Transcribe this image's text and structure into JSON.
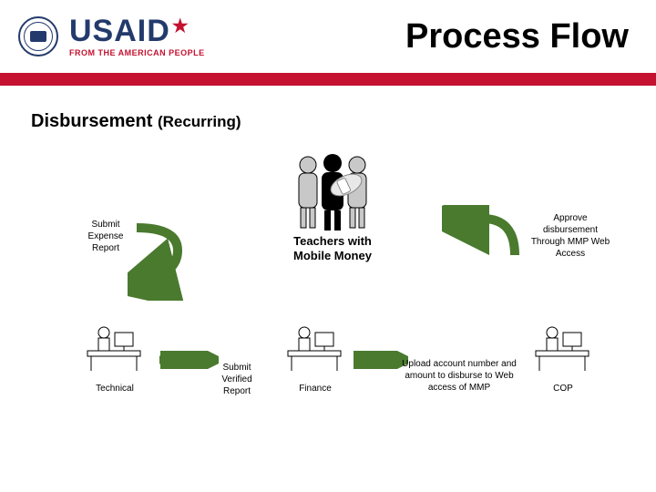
{
  "header": {
    "logo_main": "USAID",
    "logo_sub": "FROM THE AMERICAN PEOPLE",
    "title": "Process Flow"
  },
  "subtitle_main": "Disbursement ",
  "subtitle_paren": "(Recurring)",
  "labels": {
    "submit_expense": "Submit Expense Report",
    "teachers": "Teachers with Mobile Money",
    "approve": "Approve disbursement Through MMP Web Access",
    "submit_verified": "Submit Verified Report",
    "upload": "Upload account number and amount to disburse to Web access of MMP"
  },
  "roles": {
    "technical": "Technical",
    "finance": "Finance",
    "cop": "COP"
  }
}
